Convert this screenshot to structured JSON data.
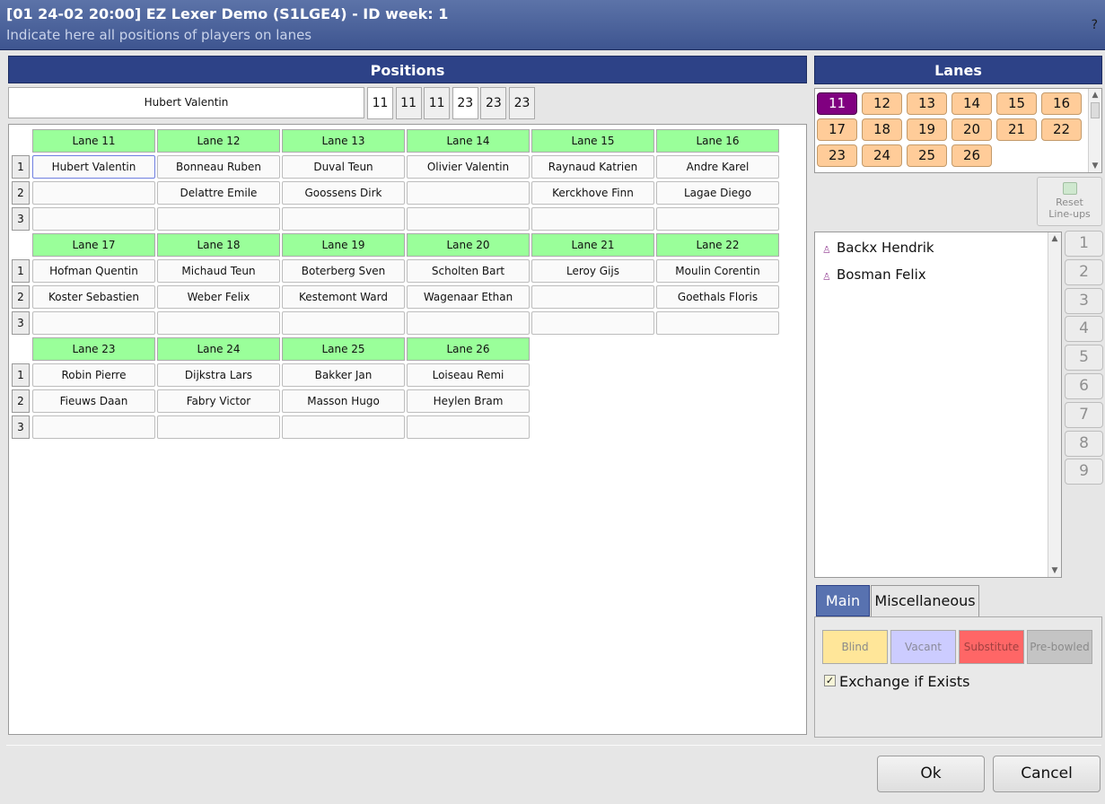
{
  "titlebar": {
    "title": "[01 24-02 20:00] EZ Lexer Demo (S1LGE4) - ID week: 1",
    "subtitle": "Indicate here all positions of players on lanes",
    "help": "?"
  },
  "positions": {
    "header": "Positions",
    "selected_player": "Hubert Valentin",
    "lane_chips": [
      "11",
      "11",
      "11",
      "23",
      "23",
      "23"
    ],
    "row_labels": [
      "1",
      "2",
      "3"
    ],
    "groups": [
      {
        "lanes": [
          {
            "label": "Lane 11",
            "slots": [
              "Hubert Valentin",
              "",
              ""
            ]
          },
          {
            "label": "Lane 12",
            "slots": [
              "Bonneau Ruben",
              "Delattre Emile",
              ""
            ]
          },
          {
            "label": "Lane 13",
            "slots": [
              "Duval Teun",
              "Goossens Dirk",
              ""
            ]
          },
          {
            "label": "Lane 14",
            "slots": [
              "Olivier Valentin",
              "",
              ""
            ]
          },
          {
            "label": "Lane 15",
            "slots": [
              "Raynaud Katrien",
              "Kerckhove Finn",
              ""
            ]
          },
          {
            "label": "Lane 16",
            "slots": [
              "Andre Karel",
              "Lagae Diego",
              ""
            ]
          }
        ]
      },
      {
        "lanes": [
          {
            "label": "Lane 17",
            "slots": [
              "Hofman Quentin",
              "Koster Sebastien",
              ""
            ]
          },
          {
            "label": "Lane 18",
            "slots": [
              "Michaud Teun",
              "Weber Felix",
              ""
            ]
          },
          {
            "label": "Lane 19",
            "slots": [
              "Boterberg Sven",
              "Kestemont Ward",
              ""
            ]
          },
          {
            "label": "Lane 20",
            "slots": [
              "Scholten Bart",
              "Wagenaar Ethan",
              ""
            ]
          },
          {
            "label": "Lane 21",
            "slots": [
              "Leroy Gijs",
              "",
              ""
            ]
          },
          {
            "label": "Lane 22",
            "slots": [
              "Moulin Corentin",
              "Goethals Floris",
              ""
            ]
          }
        ]
      },
      {
        "lanes": [
          {
            "label": "Lane 23",
            "slots": [
              "Robin Pierre",
              "Fieuws Daan",
              ""
            ]
          },
          {
            "label": "Lane 24",
            "slots": [
              "Dijkstra Lars",
              "Fabry Victor",
              ""
            ]
          },
          {
            "label": "Lane 25",
            "slots": [
              "Bakker Jan",
              "Masson Hugo",
              ""
            ]
          },
          {
            "label": "Lane 26",
            "slots": [
              "Loiseau Remi",
              "Heylen Bram",
              ""
            ]
          }
        ]
      }
    ]
  },
  "lanes_panel": {
    "header": "Lanes",
    "lanes": [
      "11",
      "12",
      "13",
      "14",
      "15",
      "16",
      "17",
      "18",
      "19",
      "20",
      "21",
      "22",
      "23",
      "24",
      "25",
      "26"
    ],
    "active": "11",
    "reset_label": "Reset Line-ups"
  },
  "players": [
    "Backx Hendrik",
    "Bosman Felix"
  ],
  "number_buttons": [
    "1",
    "2",
    "3",
    "4",
    "5",
    "6",
    "7",
    "8",
    "9"
  ],
  "tabs": {
    "main": "Main",
    "misc": "Miscellaneous"
  },
  "status_buttons": [
    {
      "label": "Blind",
      "bg": "#ffe699",
      "fg": "#8a8a8a"
    },
    {
      "label": "Vacant",
      "bg": "#ccccff",
      "fg": "#8a8a9a"
    },
    {
      "label": "Substitute",
      "bg": "#ff6666",
      "fg": "#a04040"
    },
    {
      "label": "Pre-bowled",
      "bg": "#c4c4c4",
      "fg": "#8a8a8a"
    }
  ],
  "exchange": {
    "label": "Exchange if Exists",
    "checked": true,
    "mark": "✓"
  },
  "dialog": {
    "ok": "Ok",
    "cancel": "Cancel"
  },
  "colors": {
    "header": "#2d4287",
    "lane_header": "#9aff9a",
    "lane_button": "#ffcc99",
    "lane_active": "#800080"
  }
}
